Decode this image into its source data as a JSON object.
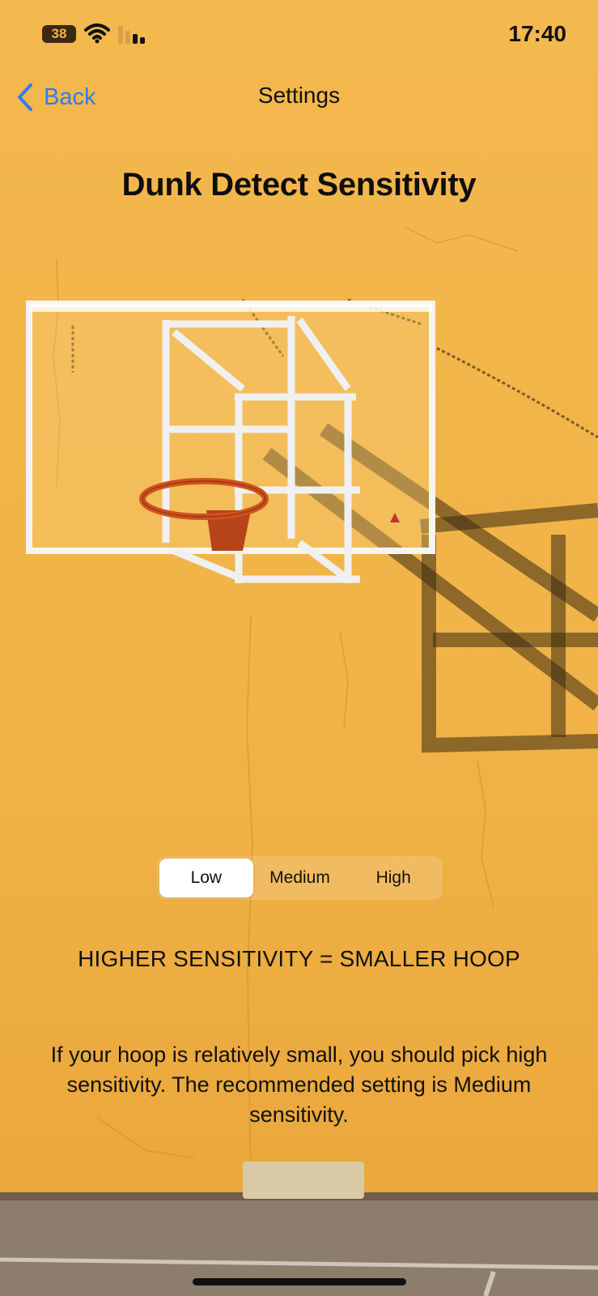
{
  "status_bar": {
    "battery": "38",
    "time": "17:40"
  },
  "nav": {
    "back_label": "Back",
    "title": "Settings"
  },
  "page": {
    "title": "Dunk Detect Sensitivity"
  },
  "sensitivity": {
    "options": [
      "Low",
      "Medium",
      "High"
    ],
    "selected": "Low"
  },
  "tagline": "HIGHER SENSITIVITY = SMALLER HOOP",
  "description": "If your hoop is relatively small, you should pick high sensitivity. The recommended setting is Medium sensitivity.",
  "colors": {
    "background": "#f2b54a",
    "accent": "#2f7cf6",
    "rim": "#d0521e"
  },
  "icons": [
    "battery-icon",
    "wifi-icon",
    "signal-icon",
    "chevron-left-icon"
  ]
}
